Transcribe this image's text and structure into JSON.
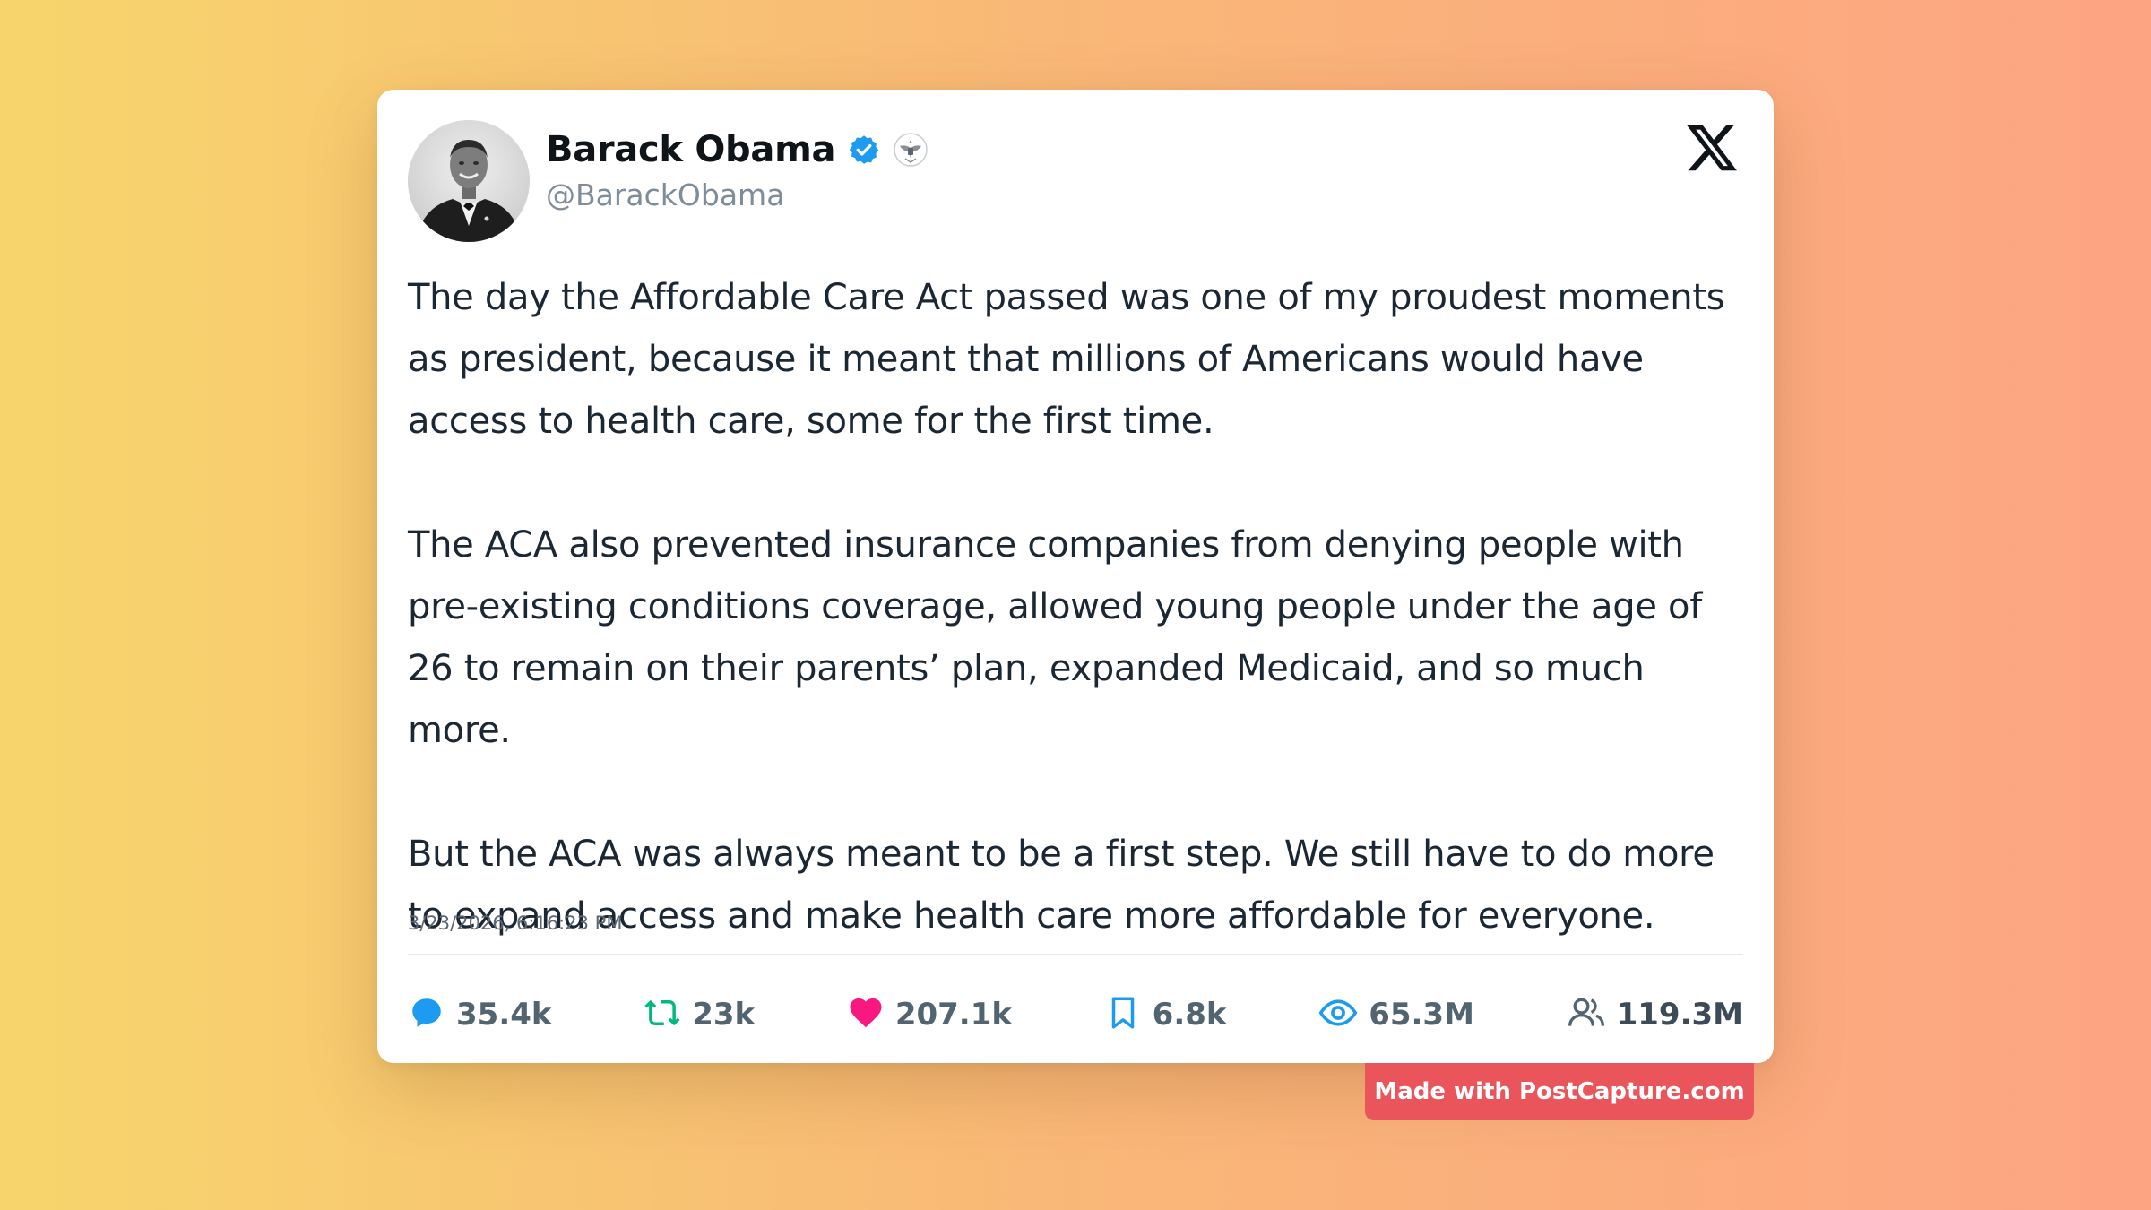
{
  "author": {
    "name": "Barack Obama",
    "handle": "@BarackObama",
    "verified": true,
    "affiliation_badge": "government-seal-icon"
  },
  "platform_logo": "x-logo-icon",
  "tweet": {
    "paragraphs": [
      "The day the Affordable Care Act passed was one of my proudest moments as president, because it meant that millions of Americans would have access to health care, some for the first time.",
      "The ACA also prevented insurance companies from denying people with pre-existing conditions coverage, allowed young people under the age of 26 to remain on their parents’ plan, expanded Medicaid, and so much more.",
      "But the ACA was always meant to be a first step. We still have to do more to expand access and make health care more affordable for everyone."
    ],
    "timestamp": "3/23/2026, 6:16:23 PM"
  },
  "stats": {
    "replies": "35.4k",
    "retweets": "23k",
    "likes": "207.1k",
    "bookmarks": "6.8k",
    "views": "65.3M",
    "followers": "119.3M"
  },
  "colors": {
    "reply": "#1d9bf0",
    "retweet": "#00ba7c",
    "like": "#f91880",
    "bookmark": "#1d9bf0",
    "views": "#1d9bf0",
    "followers": "#536471",
    "verified": "#1d9bf0",
    "badge_bg": "#e9555a"
  },
  "watermark": "Made with PostCapture.com"
}
